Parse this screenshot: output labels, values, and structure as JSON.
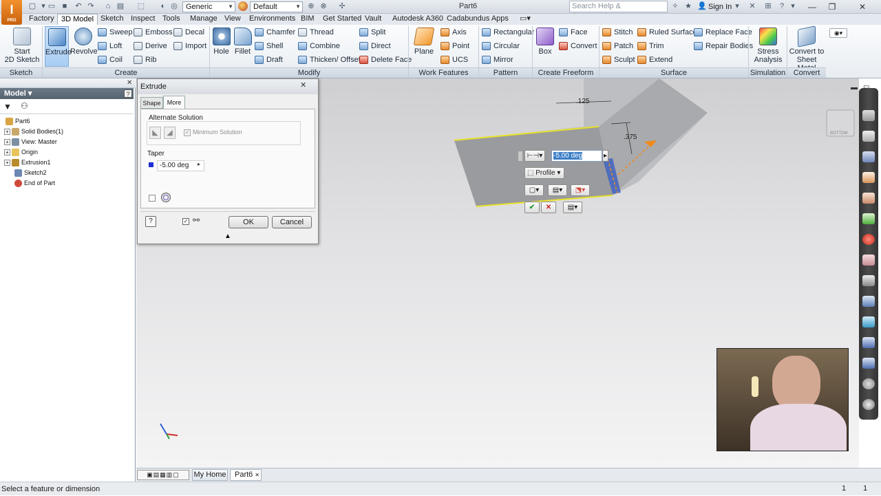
{
  "app": {
    "logo_text": "I",
    "logo_sub": "PRO",
    "document_title": "Part6"
  },
  "quick_access": {
    "appearance_combo": "Generic",
    "style_combo": "Default"
  },
  "search": {
    "placeholder": "Search Help & Commands..."
  },
  "account": {
    "sign_in": "Sign In"
  },
  "ribbon_tabs": [
    "Factory",
    "3D Model",
    "Sketch",
    "Inspect",
    "Tools",
    "Manage",
    "View",
    "Environments",
    "BIM",
    "Get Started",
    "Vault",
    "Autodesk A360",
    "Cadabundus Apps"
  ],
  "ribbon": {
    "sketch": {
      "start_sketch": "Start",
      "start_sketch_2": "2D Sketch",
      "panel": "Sketch"
    },
    "create": {
      "extrude": "Extrude",
      "revolve": "Revolve",
      "sweep": "Sweep",
      "loft": "Loft",
      "coil": "Coil",
      "emboss": "Emboss",
      "derive": "Derive",
      "rib": "Rib",
      "decal": "Decal",
      "import": "Import",
      "panel": "Create"
    },
    "modify": {
      "hole": "Hole",
      "fillet": "Fillet",
      "chamfer": "Chamfer",
      "shell": "Shell",
      "draft": "Draft",
      "thread": "Thread",
      "combine": "Combine",
      "thicken": "Thicken/ Offset",
      "split": "Split",
      "direct": "Direct",
      "delete_face": "Delete Face",
      "panel": "Modify"
    },
    "work_features": {
      "plane": "Plane",
      "axis": "Axis",
      "point": "Point",
      "ucs": "UCS",
      "panel": "Work Features"
    },
    "pattern": {
      "rectangular": "Rectangular",
      "circular": "Circular",
      "mirror": "Mirror",
      "panel": "Pattern"
    },
    "freeform": {
      "box": "Box",
      "face": "Face",
      "convert": "Convert",
      "panel": "Create Freeform"
    },
    "surface": {
      "stitch": "Stitch",
      "patch": "Patch",
      "sculpt": "Sculpt",
      "ruled_surface": "Ruled Surface",
      "trim": "Trim",
      "extend": "Extend",
      "replace_face": "Replace Face",
      "repair_bodies": "Repair Bodies",
      "panel": "Surface"
    },
    "simulation": {
      "stress": "Stress",
      "stress_2": "Analysis",
      "panel": "Simulation"
    },
    "convert": {
      "sheet_metal": "Convert to",
      "sheet_metal_2": "Sheet Metal",
      "panel": "Convert"
    }
  },
  "browser": {
    "title": "Model",
    "items": [
      {
        "label": "Part6",
        "color": "#d9a441"
      },
      {
        "label": "Solid Bodies(1)",
        "color": "#c9a86b"
      },
      {
        "label": "View: Master",
        "color": "#7d8fa3"
      },
      {
        "label": "Origin",
        "color": "#e8c25a"
      },
      {
        "label": "Extrusion1",
        "color": "#b88a2e"
      },
      {
        "label": "Sketch2",
        "color": "#6d88b4"
      },
      {
        "label": "End of Part",
        "color": "#d04a3a"
      }
    ]
  },
  "dialog": {
    "title": "Extrude",
    "tab_shape": "Shape",
    "tab_more": "More",
    "alternate_solution": "Alternate Solution",
    "minimum_solution": "Minimum Solution",
    "taper_label": "Taper",
    "taper_value": "-5.00 deg",
    "ok": "OK",
    "cancel": "Cancel"
  },
  "viewport": {
    "dim_top": ".125",
    "dim_side": ".375",
    "mini_value": "-5.00 deg",
    "profile_label": "Profile",
    "viewcube_label": "BOTTOM"
  },
  "doc_tabs": {
    "home": "My Home",
    "part": "Part6"
  },
  "status": {
    "message": "Select a feature or dimension",
    "count_a": "1",
    "count_b": "1"
  },
  "colors": {
    "accent": "#3d7fc6",
    "edge_highlight": "#e8e22a",
    "preview": "#f08a1c"
  }
}
